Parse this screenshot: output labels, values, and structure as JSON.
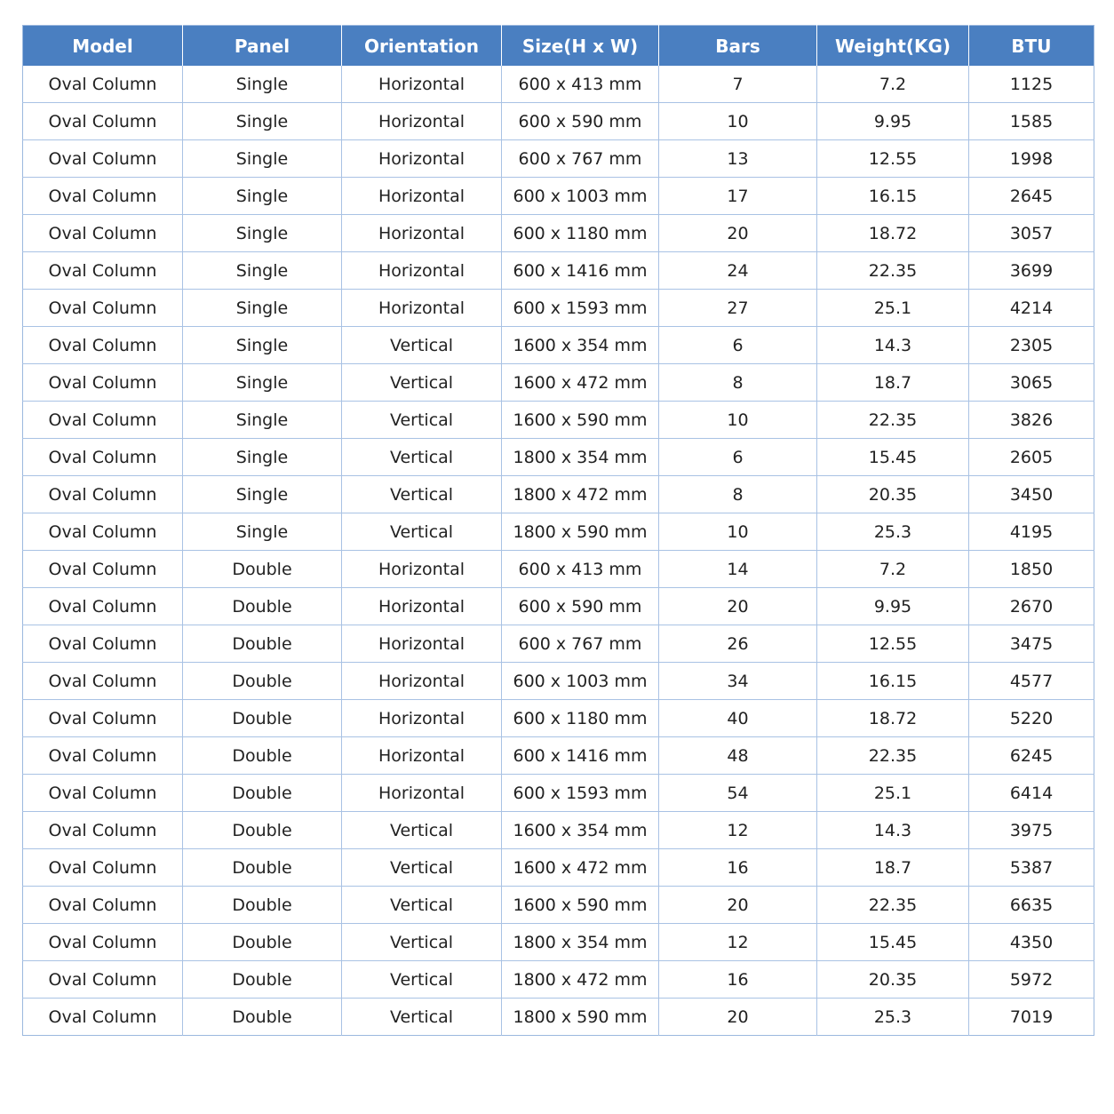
{
  "table": {
    "headers": [
      "Model",
      "Panel",
      "Orientation",
      "Size(H x W)",
      "Bars",
      "Weight(KG)",
      "BTU"
    ],
    "rows": [
      [
        "Oval Column",
        "Single",
        "Horizontal",
        "600 x 413 mm",
        "7",
        "7.2",
        "1125"
      ],
      [
        "Oval Column",
        "Single",
        "Horizontal",
        "600 x 590 mm",
        "10",
        "9.95",
        "1585"
      ],
      [
        "Oval Column",
        "Single",
        "Horizontal",
        "600 x 767 mm",
        "13",
        "12.55",
        "1998"
      ],
      [
        "Oval Column",
        "Single",
        "Horizontal",
        "600 x 1003 mm",
        "17",
        "16.15",
        "2645"
      ],
      [
        "Oval Column",
        "Single",
        "Horizontal",
        "600 x 1180 mm",
        "20",
        "18.72",
        "3057"
      ],
      [
        "Oval Column",
        "Single",
        "Horizontal",
        "600 x 1416 mm",
        "24",
        "22.35",
        "3699"
      ],
      [
        "Oval Column",
        "Single",
        "Horizontal",
        "600 x 1593 mm",
        "27",
        "25.1",
        "4214"
      ],
      [
        "Oval Column",
        "Single",
        "Vertical",
        "1600 x 354 mm",
        "6",
        "14.3",
        "2305"
      ],
      [
        "Oval Column",
        "Single",
        "Vertical",
        "1600 x 472 mm",
        "8",
        "18.7",
        "3065"
      ],
      [
        "Oval Column",
        "Single",
        "Vertical",
        "1600 x 590 mm",
        "10",
        "22.35",
        "3826"
      ],
      [
        "Oval Column",
        "Single",
        "Vertical",
        "1800 x 354 mm",
        "6",
        "15.45",
        "2605"
      ],
      [
        "Oval Column",
        "Single",
        "Vertical",
        "1800 x 472 mm",
        "8",
        "20.35",
        "3450"
      ],
      [
        "Oval Column",
        "Single",
        "Vertical",
        "1800 x 590 mm",
        "10",
        "25.3",
        "4195"
      ],
      [
        "Oval Column",
        "Double",
        "Horizontal",
        "600 x 413 mm",
        "14",
        "7.2",
        "1850"
      ],
      [
        "Oval Column",
        "Double",
        "Horizontal",
        "600 x 590 mm",
        "20",
        "9.95",
        "2670"
      ],
      [
        "Oval Column",
        "Double",
        "Horizontal",
        "600 x 767 mm",
        "26",
        "12.55",
        "3475"
      ],
      [
        "Oval Column",
        "Double",
        "Horizontal",
        "600 x 1003 mm",
        "34",
        "16.15",
        "4577"
      ],
      [
        "Oval Column",
        "Double",
        "Horizontal",
        "600 x 1180 mm",
        "40",
        "18.72",
        "5220"
      ],
      [
        "Oval Column",
        "Double",
        "Horizontal",
        "600 x 1416 mm",
        "48",
        "22.35",
        "6245"
      ],
      [
        "Oval Column",
        "Double",
        "Horizontal",
        "600 x 1593 mm",
        "54",
        "25.1",
        "6414"
      ],
      [
        "Oval Column",
        "Double",
        "Vertical",
        "1600 x 354 mm",
        "12",
        "14.3",
        "3975"
      ],
      [
        "Oval Column",
        "Double",
        "Vertical",
        "1600 x 472 mm",
        "16",
        "18.7",
        "5387"
      ],
      [
        "Oval Column",
        "Double",
        "Vertical",
        "1600 x 590 mm",
        "20",
        "22.35",
        "6635"
      ],
      [
        "Oval Column",
        "Double",
        "Vertical",
        "1800 x 354 mm",
        "12",
        "15.45",
        "4350"
      ],
      [
        "Oval Column",
        "Double",
        "Vertical",
        "1800 x 472 mm",
        "16",
        "20.35",
        "5972"
      ],
      [
        "Oval Column",
        "Double",
        "Vertical",
        "1800 x 590 mm",
        "20",
        "25.3",
        "7019"
      ]
    ]
  },
  "colors": {
    "header_background": "#4a7fc1",
    "header_text": "#ffffff",
    "grid_lines": "#a9c2e4",
    "body_text": "#222222"
  }
}
